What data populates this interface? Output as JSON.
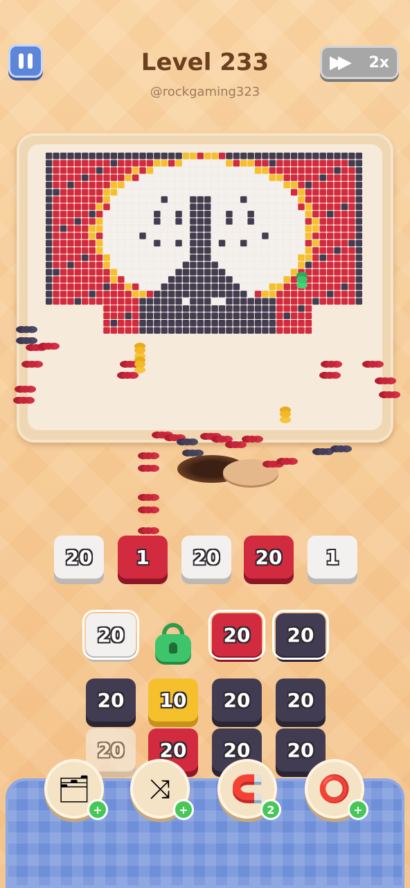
{
  "header": {
    "title": "Level 233",
    "subtitle": "@rockgaming323",
    "speed_label": "2x"
  },
  "icons": {
    "pause": "pause-icon",
    "speed": "fast-forward-icon",
    "lock": "lock-icon"
  },
  "colors": {
    "red": "#d22a3e",
    "dark": "#423c52",
    "white": "#f3f1ef",
    "yellow": "#f6bf2c",
    "green": "#3ec46a",
    "tray": "#6f8fd8"
  },
  "queue": [
    {
      "value": "20",
      "color": "white"
    },
    {
      "value": "1",
      "color": "red"
    },
    {
      "value": "20",
      "color": "white"
    },
    {
      "value": "20",
      "color": "red"
    },
    {
      "value": "1",
      "color": "white"
    }
  ],
  "grid": [
    [
      {
        "value": "20",
        "color": "white"
      },
      {
        "value": "",
        "color": "locked"
      },
      {
        "value": "20",
        "color": "red"
      },
      {
        "value": "20",
        "color": "dark"
      }
    ],
    [
      {
        "value": "20",
        "color": "dark"
      },
      {
        "value": "10",
        "color": "yellow"
      },
      {
        "value": "20",
        "color": "dark"
      },
      {
        "value": "20",
        "color": "dark"
      }
    ],
    [
      {
        "value": "20",
        "color": "white"
      },
      {
        "value": "20",
        "color": "red"
      },
      {
        "value": "20",
        "color": "dark"
      },
      {
        "value": "20",
        "color": "dark"
      }
    ]
  ],
  "powerups": [
    {
      "name": "add-box",
      "icon": "add-box-icon",
      "badge": "+"
    },
    {
      "name": "shuffle",
      "icon": "shuffle-icon",
      "badge": "+"
    },
    {
      "name": "magnet",
      "icon": "magnet-icon",
      "badge": "2"
    },
    {
      "name": "donut",
      "icon": "ring-icon",
      "badge": "+"
    }
  ]
}
